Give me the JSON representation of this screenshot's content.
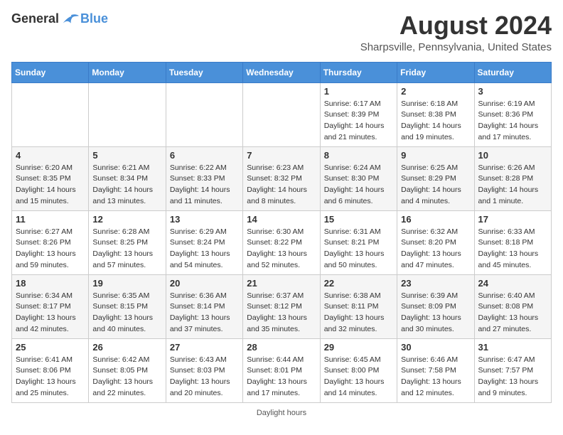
{
  "logo": {
    "general": "General",
    "blue": "Blue"
  },
  "title": "August 2024",
  "location": "Sharpsville, Pennsylvania, United States",
  "days_of_week": [
    "Sunday",
    "Monday",
    "Tuesday",
    "Wednesday",
    "Thursday",
    "Friday",
    "Saturday"
  ],
  "weeks": [
    [
      {
        "day": "",
        "info": ""
      },
      {
        "day": "",
        "info": ""
      },
      {
        "day": "",
        "info": ""
      },
      {
        "day": "",
        "info": ""
      },
      {
        "day": "1",
        "sunrise": "Sunrise: 6:17 AM",
        "sunset": "Sunset: 8:39 PM",
        "daylight": "Daylight: 14 hours and 21 minutes."
      },
      {
        "day": "2",
        "sunrise": "Sunrise: 6:18 AM",
        "sunset": "Sunset: 8:38 PM",
        "daylight": "Daylight: 14 hours and 19 minutes."
      },
      {
        "day": "3",
        "sunrise": "Sunrise: 6:19 AM",
        "sunset": "Sunset: 8:36 PM",
        "daylight": "Daylight: 14 hours and 17 minutes."
      }
    ],
    [
      {
        "day": "4",
        "sunrise": "Sunrise: 6:20 AM",
        "sunset": "Sunset: 8:35 PM",
        "daylight": "Daylight: 14 hours and 15 minutes."
      },
      {
        "day": "5",
        "sunrise": "Sunrise: 6:21 AM",
        "sunset": "Sunset: 8:34 PM",
        "daylight": "Daylight: 14 hours and 13 minutes."
      },
      {
        "day": "6",
        "sunrise": "Sunrise: 6:22 AM",
        "sunset": "Sunset: 8:33 PM",
        "daylight": "Daylight: 14 hours and 11 minutes."
      },
      {
        "day": "7",
        "sunrise": "Sunrise: 6:23 AM",
        "sunset": "Sunset: 8:32 PM",
        "daylight": "Daylight: 14 hours and 8 minutes."
      },
      {
        "day": "8",
        "sunrise": "Sunrise: 6:24 AM",
        "sunset": "Sunset: 8:30 PM",
        "daylight": "Daylight: 14 hours and 6 minutes."
      },
      {
        "day": "9",
        "sunrise": "Sunrise: 6:25 AM",
        "sunset": "Sunset: 8:29 PM",
        "daylight": "Daylight: 14 hours and 4 minutes."
      },
      {
        "day": "10",
        "sunrise": "Sunrise: 6:26 AM",
        "sunset": "Sunset: 8:28 PM",
        "daylight": "Daylight: 14 hours and 1 minute."
      }
    ],
    [
      {
        "day": "11",
        "sunrise": "Sunrise: 6:27 AM",
        "sunset": "Sunset: 8:26 PM",
        "daylight": "Daylight: 13 hours and 59 minutes."
      },
      {
        "day": "12",
        "sunrise": "Sunrise: 6:28 AM",
        "sunset": "Sunset: 8:25 PM",
        "daylight": "Daylight: 13 hours and 57 minutes."
      },
      {
        "day": "13",
        "sunrise": "Sunrise: 6:29 AM",
        "sunset": "Sunset: 8:24 PM",
        "daylight": "Daylight: 13 hours and 54 minutes."
      },
      {
        "day": "14",
        "sunrise": "Sunrise: 6:30 AM",
        "sunset": "Sunset: 8:22 PM",
        "daylight": "Daylight: 13 hours and 52 minutes."
      },
      {
        "day": "15",
        "sunrise": "Sunrise: 6:31 AM",
        "sunset": "Sunset: 8:21 PM",
        "daylight": "Daylight: 13 hours and 50 minutes."
      },
      {
        "day": "16",
        "sunrise": "Sunrise: 6:32 AM",
        "sunset": "Sunset: 8:20 PM",
        "daylight": "Daylight: 13 hours and 47 minutes."
      },
      {
        "day": "17",
        "sunrise": "Sunrise: 6:33 AM",
        "sunset": "Sunset: 8:18 PM",
        "daylight": "Daylight: 13 hours and 45 minutes."
      }
    ],
    [
      {
        "day": "18",
        "sunrise": "Sunrise: 6:34 AM",
        "sunset": "Sunset: 8:17 PM",
        "daylight": "Daylight: 13 hours and 42 minutes."
      },
      {
        "day": "19",
        "sunrise": "Sunrise: 6:35 AM",
        "sunset": "Sunset: 8:15 PM",
        "daylight": "Daylight: 13 hours and 40 minutes."
      },
      {
        "day": "20",
        "sunrise": "Sunrise: 6:36 AM",
        "sunset": "Sunset: 8:14 PM",
        "daylight": "Daylight: 13 hours and 37 minutes."
      },
      {
        "day": "21",
        "sunrise": "Sunrise: 6:37 AM",
        "sunset": "Sunset: 8:12 PM",
        "daylight": "Daylight: 13 hours and 35 minutes."
      },
      {
        "day": "22",
        "sunrise": "Sunrise: 6:38 AM",
        "sunset": "Sunset: 8:11 PM",
        "daylight": "Daylight: 13 hours and 32 minutes."
      },
      {
        "day": "23",
        "sunrise": "Sunrise: 6:39 AM",
        "sunset": "Sunset: 8:09 PM",
        "daylight": "Daylight: 13 hours and 30 minutes."
      },
      {
        "day": "24",
        "sunrise": "Sunrise: 6:40 AM",
        "sunset": "Sunset: 8:08 PM",
        "daylight": "Daylight: 13 hours and 27 minutes."
      }
    ],
    [
      {
        "day": "25",
        "sunrise": "Sunrise: 6:41 AM",
        "sunset": "Sunset: 8:06 PM",
        "daylight": "Daylight: 13 hours and 25 minutes."
      },
      {
        "day": "26",
        "sunrise": "Sunrise: 6:42 AM",
        "sunset": "Sunset: 8:05 PM",
        "daylight": "Daylight: 13 hours and 22 minutes."
      },
      {
        "day": "27",
        "sunrise": "Sunrise: 6:43 AM",
        "sunset": "Sunset: 8:03 PM",
        "daylight": "Daylight: 13 hours and 20 minutes."
      },
      {
        "day": "28",
        "sunrise": "Sunrise: 6:44 AM",
        "sunset": "Sunset: 8:01 PM",
        "daylight": "Daylight: 13 hours and 17 minutes."
      },
      {
        "day": "29",
        "sunrise": "Sunrise: 6:45 AM",
        "sunset": "Sunset: 8:00 PM",
        "daylight": "Daylight: 13 hours and 14 minutes."
      },
      {
        "day": "30",
        "sunrise": "Sunrise: 6:46 AM",
        "sunset": "Sunset: 7:58 PM",
        "daylight": "Daylight: 13 hours and 12 minutes."
      },
      {
        "day": "31",
        "sunrise": "Sunrise: 6:47 AM",
        "sunset": "Sunset: 7:57 PM",
        "daylight": "Daylight: 13 hours and 9 minutes."
      }
    ]
  ],
  "footer": "Daylight hours"
}
